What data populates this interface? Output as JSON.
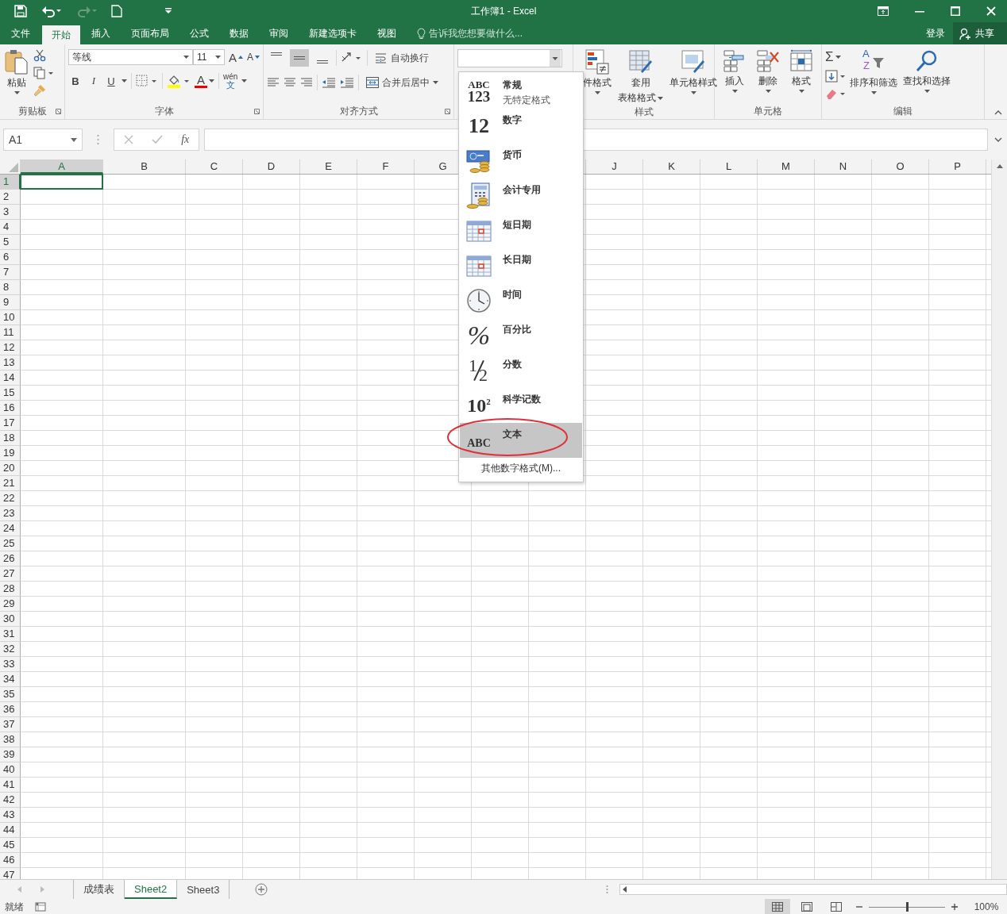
{
  "window": {
    "title": "工作簿1 - Excel"
  },
  "tabs": [
    {
      "label": "文件",
      "selected": false
    },
    {
      "label": "开始",
      "selected": true
    },
    {
      "label": "插入",
      "selected": false
    },
    {
      "label": "页面布局",
      "selected": false
    },
    {
      "label": "公式",
      "selected": false
    },
    {
      "label": "数据",
      "selected": false
    },
    {
      "label": "审阅",
      "selected": false
    },
    {
      "label": "新建选项卡",
      "selected": false
    },
    {
      "label": "视图",
      "selected": false
    }
  ],
  "tell_me": {
    "placeholder": "告诉我您想要做什么..."
  },
  "account": {
    "sign_in": "登录",
    "share": "共享"
  },
  "ribbon": {
    "clipboard": {
      "paste": "粘贴",
      "label": "剪贴板"
    },
    "font": {
      "name": "等线",
      "size": "11",
      "grow": "A",
      "shrink": "A",
      "bold": "B",
      "italic": "I",
      "underline": "U",
      "font_color": "A",
      "phonetic_top": "wén",
      "phonetic_bottom": "文",
      "label": "字体"
    },
    "alignment": {
      "vertical": [
        {
          "selected": false
        },
        {
          "selected": true
        },
        {
          "selected": false
        }
      ],
      "wrap": "自动换行",
      "merge": "合并后居中",
      "label": "对齐方式"
    },
    "styles": {
      "conditional": "件格式",
      "table_top": "套用",
      "table_bottom": "表格格式",
      "cell_styles": "单元格样式",
      "label": "样式"
    },
    "cells": {
      "insert": "插入",
      "delete": "删除",
      "format": "格式",
      "label": "单元格"
    },
    "editing": {
      "sum": "Σ",
      "sort_a": "A",
      "sort_z": "Z",
      "sort": "排序和筛选",
      "find": "查找和选择",
      "label": "编辑"
    }
  },
  "formula_bar": {
    "name_box": "A1",
    "fx": "fx"
  },
  "columns": [
    {
      "label": "A",
      "selected": true
    },
    {
      "label": "B",
      "selected": false
    },
    {
      "label": "C",
      "selected": false
    },
    {
      "label": "D",
      "selected": false
    },
    {
      "label": "E",
      "selected": false
    },
    {
      "label": "F",
      "selected": false
    },
    {
      "label": "G",
      "selected": false
    },
    {},
    {},
    {
      "label": "J",
      "selected": false
    },
    {
      "label": "K",
      "selected": false
    },
    {
      "label": "L",
      "selected": false
    },
    {
      "label": "M",
      "selected": false
    },
    {
      "label": "N",
      "selected": false
    },
    {
      "label": "O",
      "selected": false
    },
    {
      "label": "P",
      "selected": false
    }
  ],
  "rows": [
    {
      "label": "1",
      "selected": true
    },
    {
      "label": "2",
      "selected": false
    },
    {
      "label": "3",
      "selected": false
    },
    {
      "label": "4",
      "selected": false
    },
    {
      "label": "5",
      "selected": false
    },
    {
      "label": "6",
      "selected": false
    },
    {
      "label": "7",
      "selected": false
    },
    {
      "label": "8",
      "selected": false
    },
    {
      "label": "9",
      "selected": false
    },
    {
      "label": "10",
      "selected": false
    },
    {
      "label": "11",
      "selected": false
    },
    {
      "label": "12",
      "selected": false
    },
    {
      "label": "13",
      "selected": false
    },
    {
      "label": "14",
      "selected": false
    },
    {
      "label": "15",
      "selected": false
    },
    {
      "label": "16",
      "selected": false
    },
    {
      "label": "17",
      "selected": false
    },
    {
      "label": "18",
      "selected": false
    },
    {
      "label": "19",
      "selected": false
    },
    {
      "label": "20",
      "selected": false
    },
    {
      "label": "21",
      "selected": false
    },
    {
      "label": "22",
      "selected": false
    },
    {
      "label": "23",
      "selected": false
    },
    {
      "label": "24",
      "selected": false
    },
    {
      "label": "25",
      "selected": false
    },
    {
      "label": "26",
      "selected": false
    },
    {
      "label": "27",
      "selected": false
    },
    {
      "label": "28",
      "selected": false
    },
    {
      "label": "29",
      "selected": false
    },
    {
      "label": "30",
      "selected": false
    },
    {
      "label": "31",
      "selected": false
    },
    {
      "label": "32",
      "selected": false
    },
    {
      "label": "33",
      "selected": false
    },
    {
      "label": "34",
      "selected": false
    },
    {
      "label": "35",
      "selected": false
    },
    {
      "label": "36",
      "selected": false
    },
    {
      "label": "37",
      "selected": false
    },
    {
      "label": "38",
      "selected": false
    },
    {
      "label": "39",
      "selected": false
    },
    {
      "label": "40",
      "selected": false
    },
    {
      "label": "41",
      "selected": false
    },
    {
      "label": "42",
      "selected": false
    },
    {
      "label": "43",
      "selected": false
    },
    {
      "label": "44",
      "selected": false
    },
    {
      "label": "45",
      "selected": false
    },
    {
      "label": "46",
      "selected": false
    },
    {
      "label": "47",
      "selected": false
    }
  ],
  "number_format_menu": {
    "items": [
      {
        "kind": "general",
        "icon_text": [
          "ABC",
          "123"
        ],
        "label": "常规",
        "sublabel": "无特定格式",
        "selected": false
      },
      {
        "kind": "number",
        "icon_text": [
          "12"
        ],
        "label": "数字",
        "selected": false
      },
      {
        "kind": "currency",
        "label": "货币",
        "selected": false
      },
      {
        "kind": "accounting",
        "label": "会计专用",
        "selected": false
      },
      {
        "kind": "short_date",
        "label": "短日期",
        "selected": false
      },
      {
        "kind": "long_date",
        "label": "长日期",
        "selected": false
      },
      {
        "kind": "time",
        "label": "时间",
        "selected": false
      },
      {
        "kind": "percent",
        "icon_text": [
          "%"
        ],
        "label": "百分比",
        "selected": false
      },
      {
        "kind": "fraction",
        "icon_text": [
          "1",
          "2"
        ],
        "label": "分数",
        "selected": false
      },
      {
        "kind": "scientific",
        "icon_text": [
          "10",
          "2"
        ],
        "label": "科学记数",
        "selected": false
      },
      {
        "kind": "text",
        "icon_text": [
          "ABC"
        ],
        "label": "文本",
        "selected": true
      }
    ],
    "more": "其他数字格式(M)..."
  },
  "sheets": [
    {
      "label": "成绩表",
      "selected": false
    },
    {
      "label": "Sheet2",
      "selected": true
    },
    {
      "label": "Sheet3",
      "selected": false
    }
  ],
  "status_bar": {
    "status": "就绪",
    "zoom": "100%",
    "zoom_slider": {
      "level": 0.5
    }
  }
}
